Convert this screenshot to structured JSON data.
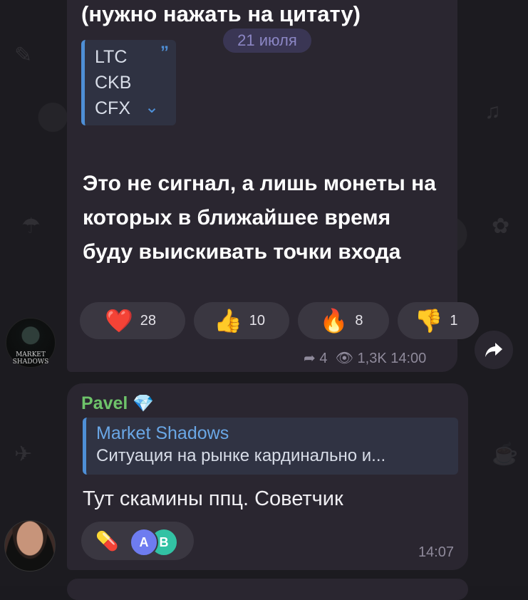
{
  "message1": {
    "top_text": "(нужно нажать на цитату)",
    "date_pill": "21 июля",
    "quote_lines": [
      "LTC",
      "CKB",
      "CFX"
    ],
    "body": "Это не сигнал, а лишь монеты на которых в ближайшее время буду выискивать точки входа",
    "reactions": [
      {
        "emoji": "❤️",
        "count": "28"
      },
      {
        "emoji": "👍",
        "count": "10"
      },
      {
        "emoji": "🔥",
        "count": "8"
      },
      {
        "emoji": "👎",
        "count": "1"
      }
    ],
    "replies": "4",
    "views": "1,3K",
    "time": "14:00",
    "channel_avatar_text": "MARKET\nSHADOWS"
  },
  "message2": {
    "sender": "Pavel",
    "reply_to_name": "Market Shadows",
    "reply_snippet": "Ситуация на рынке кардинально и...",
    "body": "Тут скамины ппц. Советчик",
    "reaction_emoji": "💊",
    "reaction_avatars": [
      "А",
      "В"
    ],
    "time": "14:07"
  },
  "colors": {
    "background": "#1c1b20",
    "bubble": "#2a2630",
    "accent_blue": "#4e8fd6",
    "sender_green": "#6ec36a",
    "meta_gray": "#8f8a9b"
  }
}
